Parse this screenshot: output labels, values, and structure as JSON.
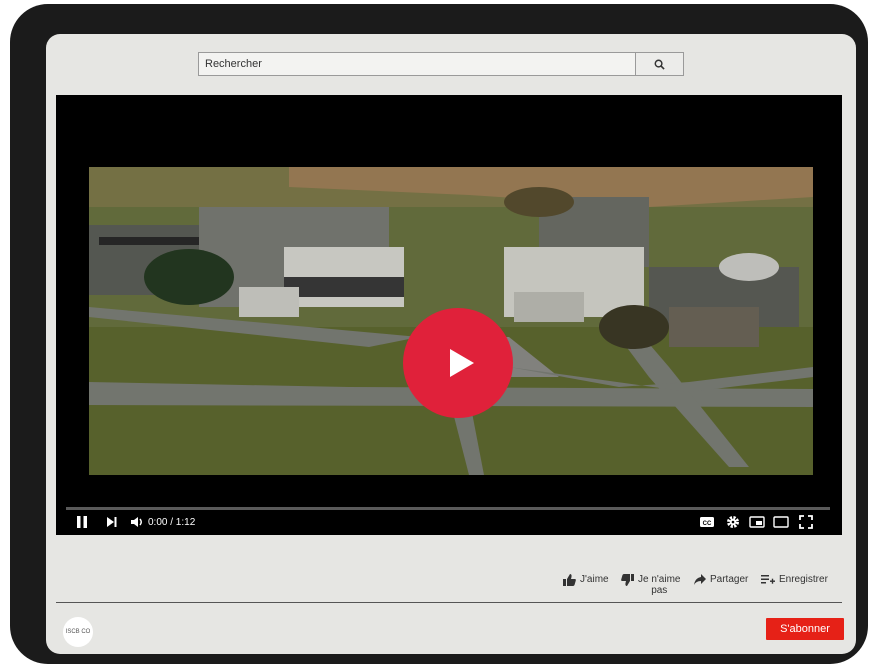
{
  "search": {
    "placeholder": "Rechercher"
  },
  "player": {
    "time": "0:00 / 1:12",
    "progress": 0,
    "cc_label": "CC"
  },
  "actions": {
    "like": "J'aime",
    "dislike_line1": "Je n'aime",
    "dislike_line2": "pas",
    "share": "Partager",
    "save": "Enregistrer"
  },
  "channel": {
    "logo_text": "ISCB CO"
  },
  "subscribe_label": "S'abonner",
  "colors": {
    "play_button": "#e0213a",
    "subscribe": "#e62117",
    "frame": "#1b1b1b"
  }
}
